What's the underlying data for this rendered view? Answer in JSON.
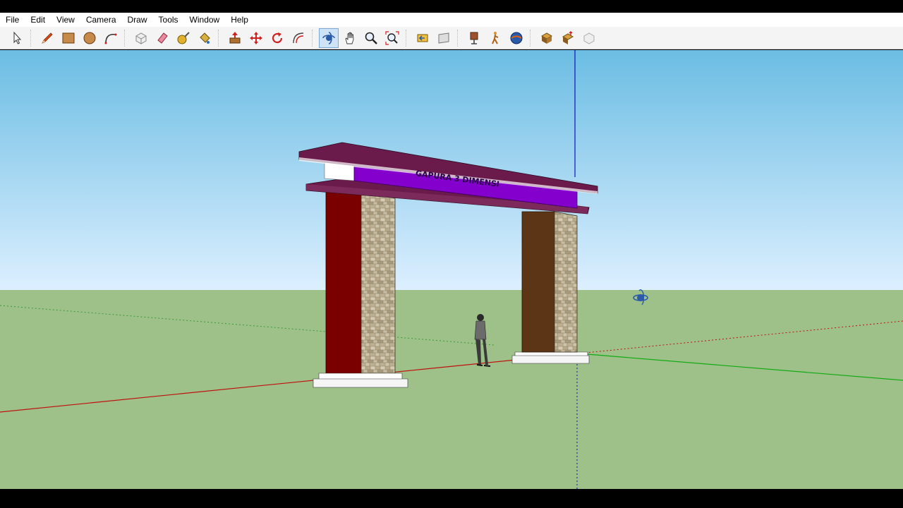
{
  "menu": {
    "file": "File",
    "edit": "Edit",
    "view": "View",
    "camera": "Camera",
    "draw": "Draw",
    "tools": "Tools",
    "window": "Window",
    "help": "Help"
  },
  "toolbar": {
    "tools": [
      "select",
      "line",
      "rectangle",
      "circle",
      "arc",
      "make-component",
      "eraser",
      "tape-measure",
      "paint-bucket",
      "push-pull",
      "move",
      "rotate",
      "offset",
      "orbit",
      "pan",
      "zoom",
      "zoom-extents",
      "previous-view",
      "next-view",
      "position-camera",
      "walk",
      "look-around",
      "get-models",
      "share-model",
      "share-component",
      "extension-warehouse"
    ],
    "active_tool": "orbit"
  },
  "model": {
    "sign_text": "GAPURA 3 DIMENSI",
    "colors": {
      "sky_top": "#6bbde3",
      "sky_bottom": "#dcefff",
      "ground": "#9ec18a",
      "beam_purple": "#8400cc",
      "beam_top": "#6b1a4c",
      "left_pillar": "#7a0000",
      "right_pillar": "#5b3515"
    }
  }
}
